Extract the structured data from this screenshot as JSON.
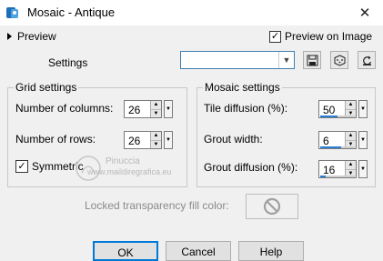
{
  "window": {
    "title": "Mosaic - Antique",
    "close_glyph": "✕",
    "icon": "app-icon"
  },
  "preview": {
    "toggle_label": "Preview",
    "preview_on_image_label": "Preview on Image",
    "preview_on_image_checked": true
  },
  "settings": {
    "label": "Settings",
    "preset_value": "",
    "tools": [
      "save-preset-icon",
      "randomize-icon",
      "reset-icon"
    ]
  },
  "grid_settings": {
    "title": "Grid settings",
    "columns_label": "Number of columns:",
    "columns_value": "26",
    "rows_label": "Number of rows:",
    "rows_value": "26",
    "symmetric_label": "Symmetric",
    "symmetric_checked": true
  },
  "mosaic_settings": {
    "title": "Mosaic settings",
    "tile_diffusion_label": "Tile diffusion (%):",
    "tile_diffusion_value": "50",
    "tile_diffusion_fraction": 0.5,
    "grout_width_label": "Grout width:",
    "grout_width_value": "6",
    "grout_width_fraction": 0.6,
    "grout_diffusion_label": "Grout diffusion (%):",
    "grout_diffusion_value": "16",
    "grout_diffusion_fraction": 0.16
  },
  "locked": {
    "label": "Locked transparency fill color:"
  },
  "watermark": {
    "line1": "Pinuccia",
    "line2": "www.maildiregrafica.eu"
  },
  "buttons": {
    "ok": "OK",
    "cancel": "Cancel",
    "help": "Help"
  },
  "colors": {
    "accent": "#0078d7",
    "slider_fill": "#2a7fd4"
  }
}
